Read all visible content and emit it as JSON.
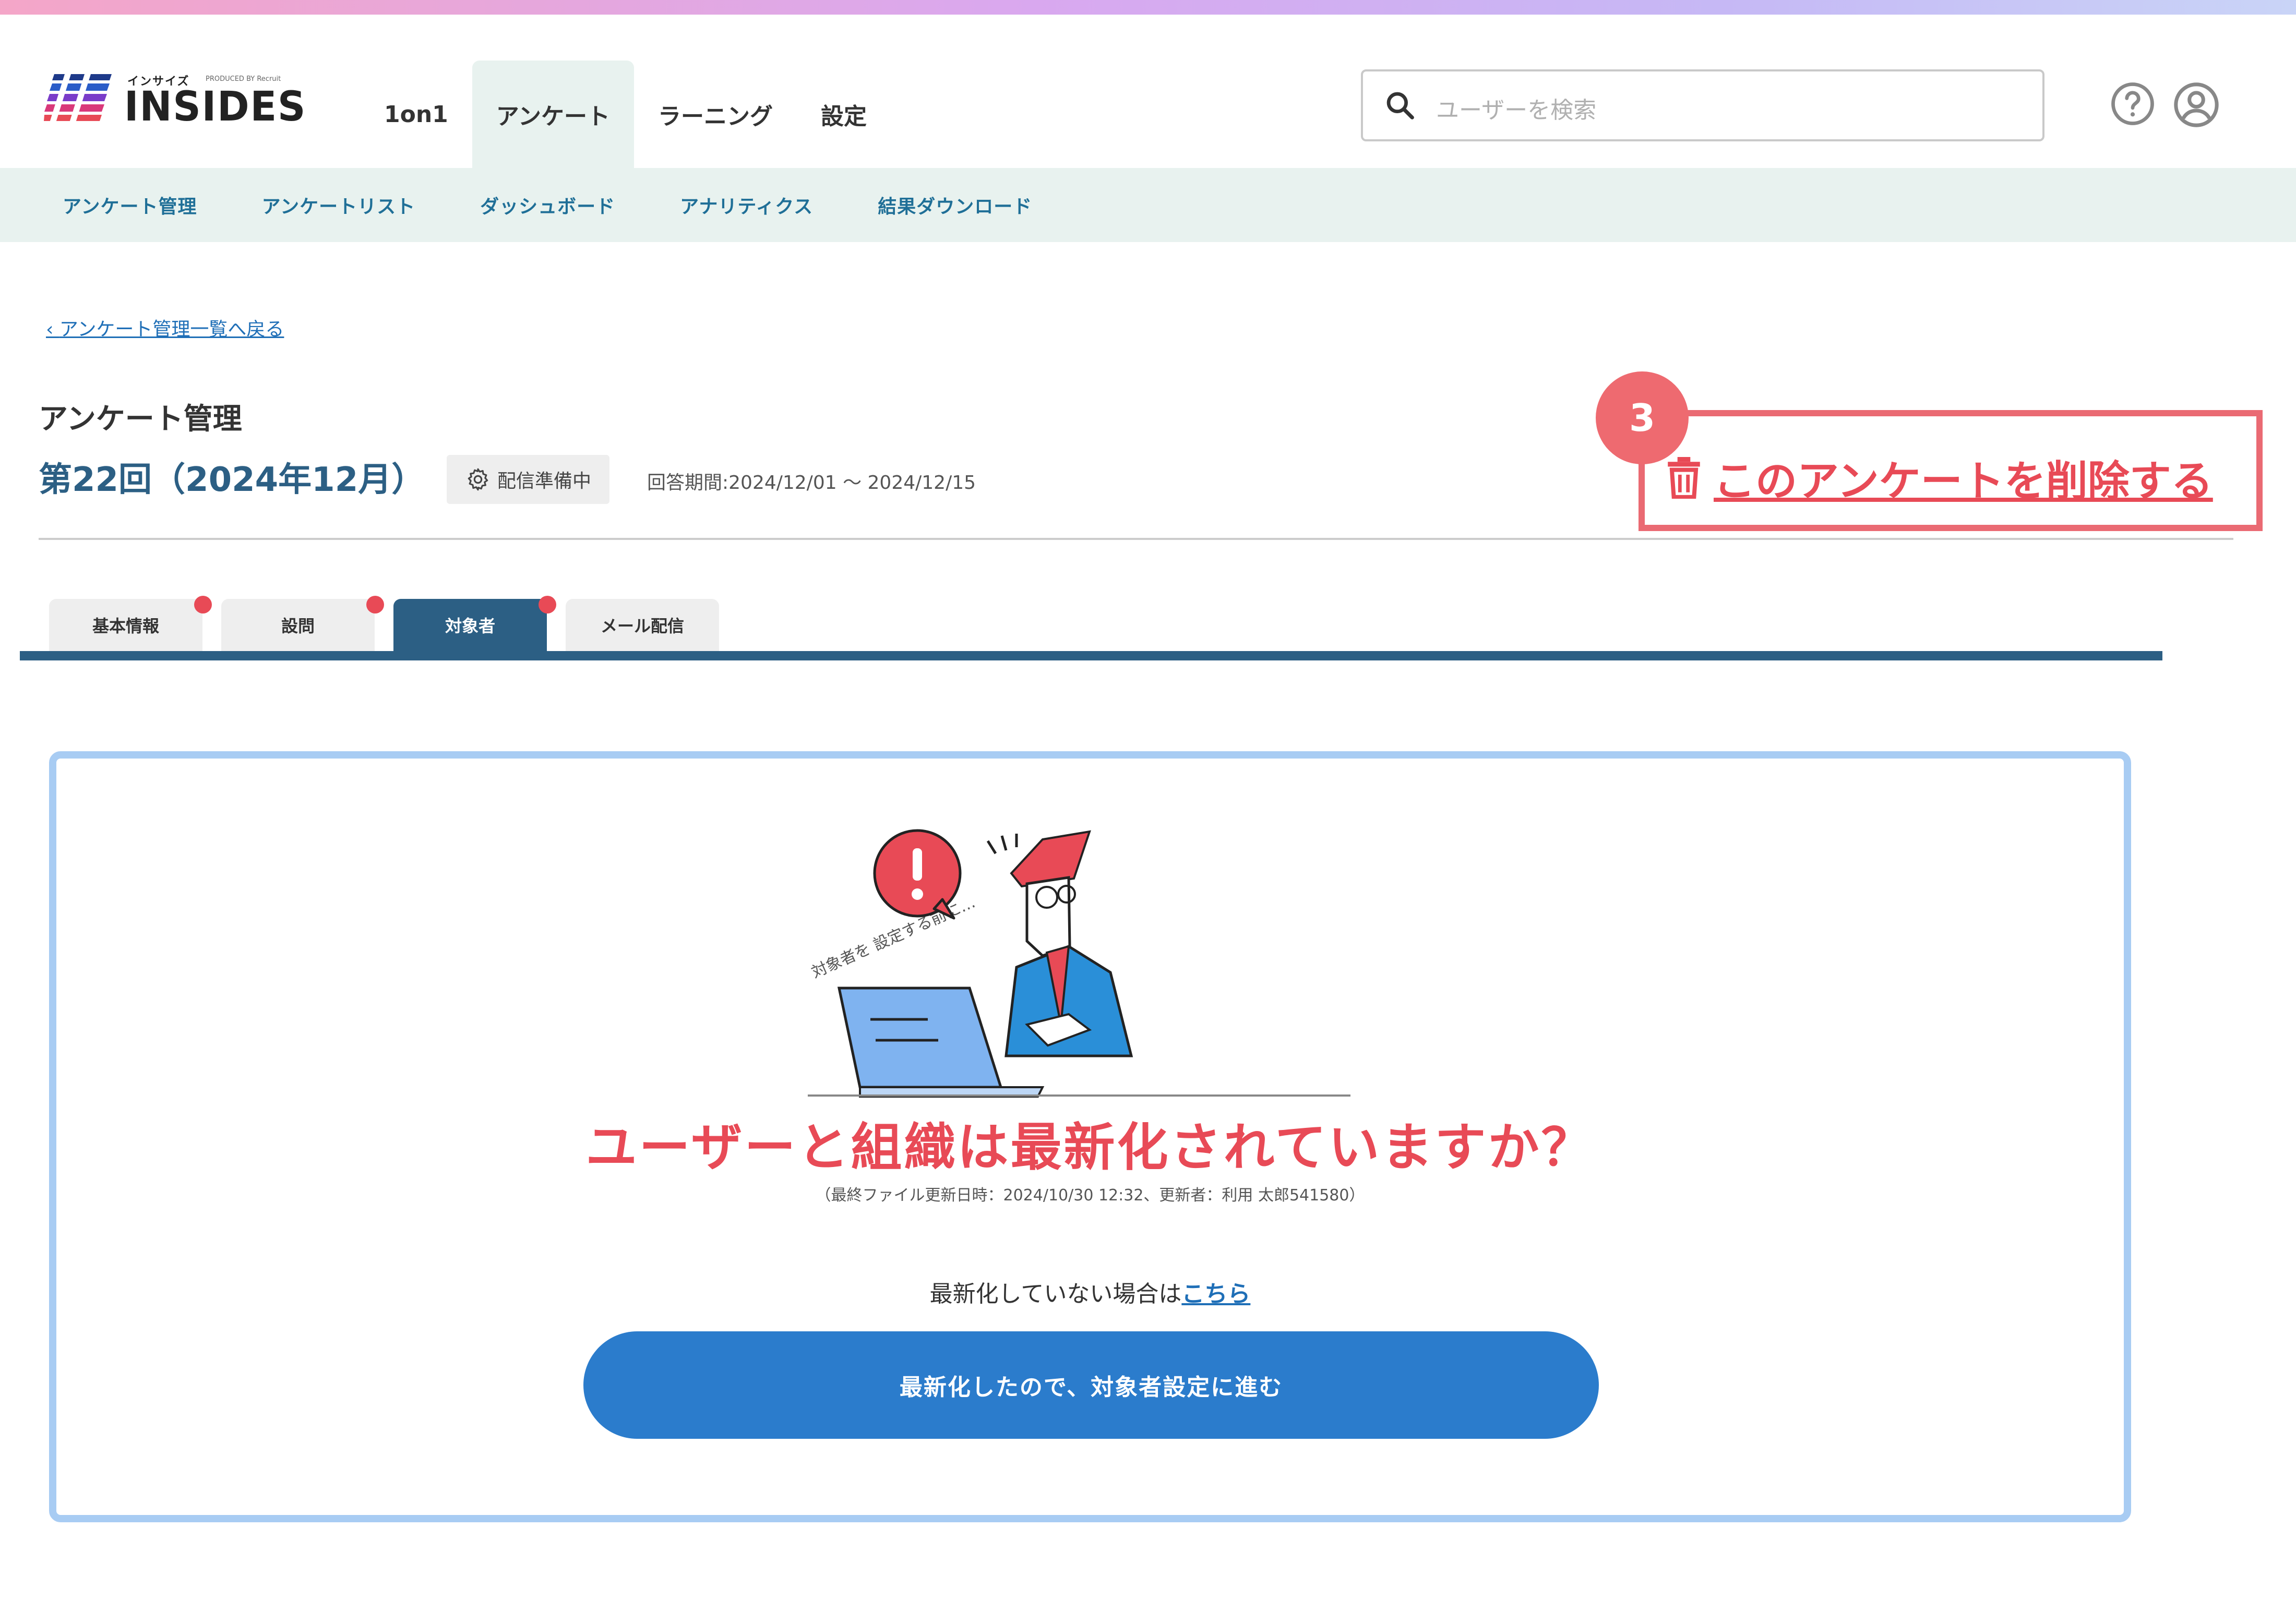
{
  "header": {
    "logo_small": "インサイズ",
    "logo_produced": "PRODUCED BY Recruit",
    "logo_text": "INSIDES",
    "nav": [
      {
        "label": "1on1",
        "active": false
      },
      {
        "label": "アンケート",
        "active": true
      },
      {
        "label": "ラーニング",
        "active": false
      },
      {
        "label": "設定",
        "active": false
      }
    ],
    "search_placeholder": "ユーザーを検索"
  },
  "subnav": [
    "アンケート管理",
    "アンケートリスト",
    "ダッシュボード",
    "アナリティクス",
    "結果ダウンロード"
  ],
  "back_link": "アンケート管理一覧へ戻る",
  "page_title": "アンケート管理",
  "survey": {
    "name": "第22回（2024年12月）",
    "status": "配信準備中",
    "period": "回答期間:2024/12/01 ～ 2024/12/15"
  },
  "delete_label": "このアンケートを削除する",
  "step_number": "3",
  "tabs": [
    {
      "label": "基本情報",
      "active": false,
      "dot": true
    },
    {
      "label": "設問",
      "active": false,
      "dot": true
    },
    {
      "label": "対象者",
      "active": true,
      "dot": true
    },
    {
      "label": "メール配信",
      "active": false,
      "dot": false
    }
  ],
  "card": {
    "illustration_caption": "対象者を 設定する前に…",
    "headline": "ユーザーと組織は最新化されていますか？",
    "update_info": "（最終ファイル更新日時：2024/10/30 12:32、更新者：利用 太郎541580）",
    "prompt_text": "最新化していない場合は",
    "prompt_link": "こちら",
    "cta_label": "最新化したので、対象者設定に進む"
  },
  "colors": {
    "accent_navy": "#2c5f84",
    "danger_red": "#e84a56",
    "cta_blue": "#2b7ccc",
    "subnav_bg": "#e8f2ef",
    "card_border": "#a8ccf3"
  }
}
